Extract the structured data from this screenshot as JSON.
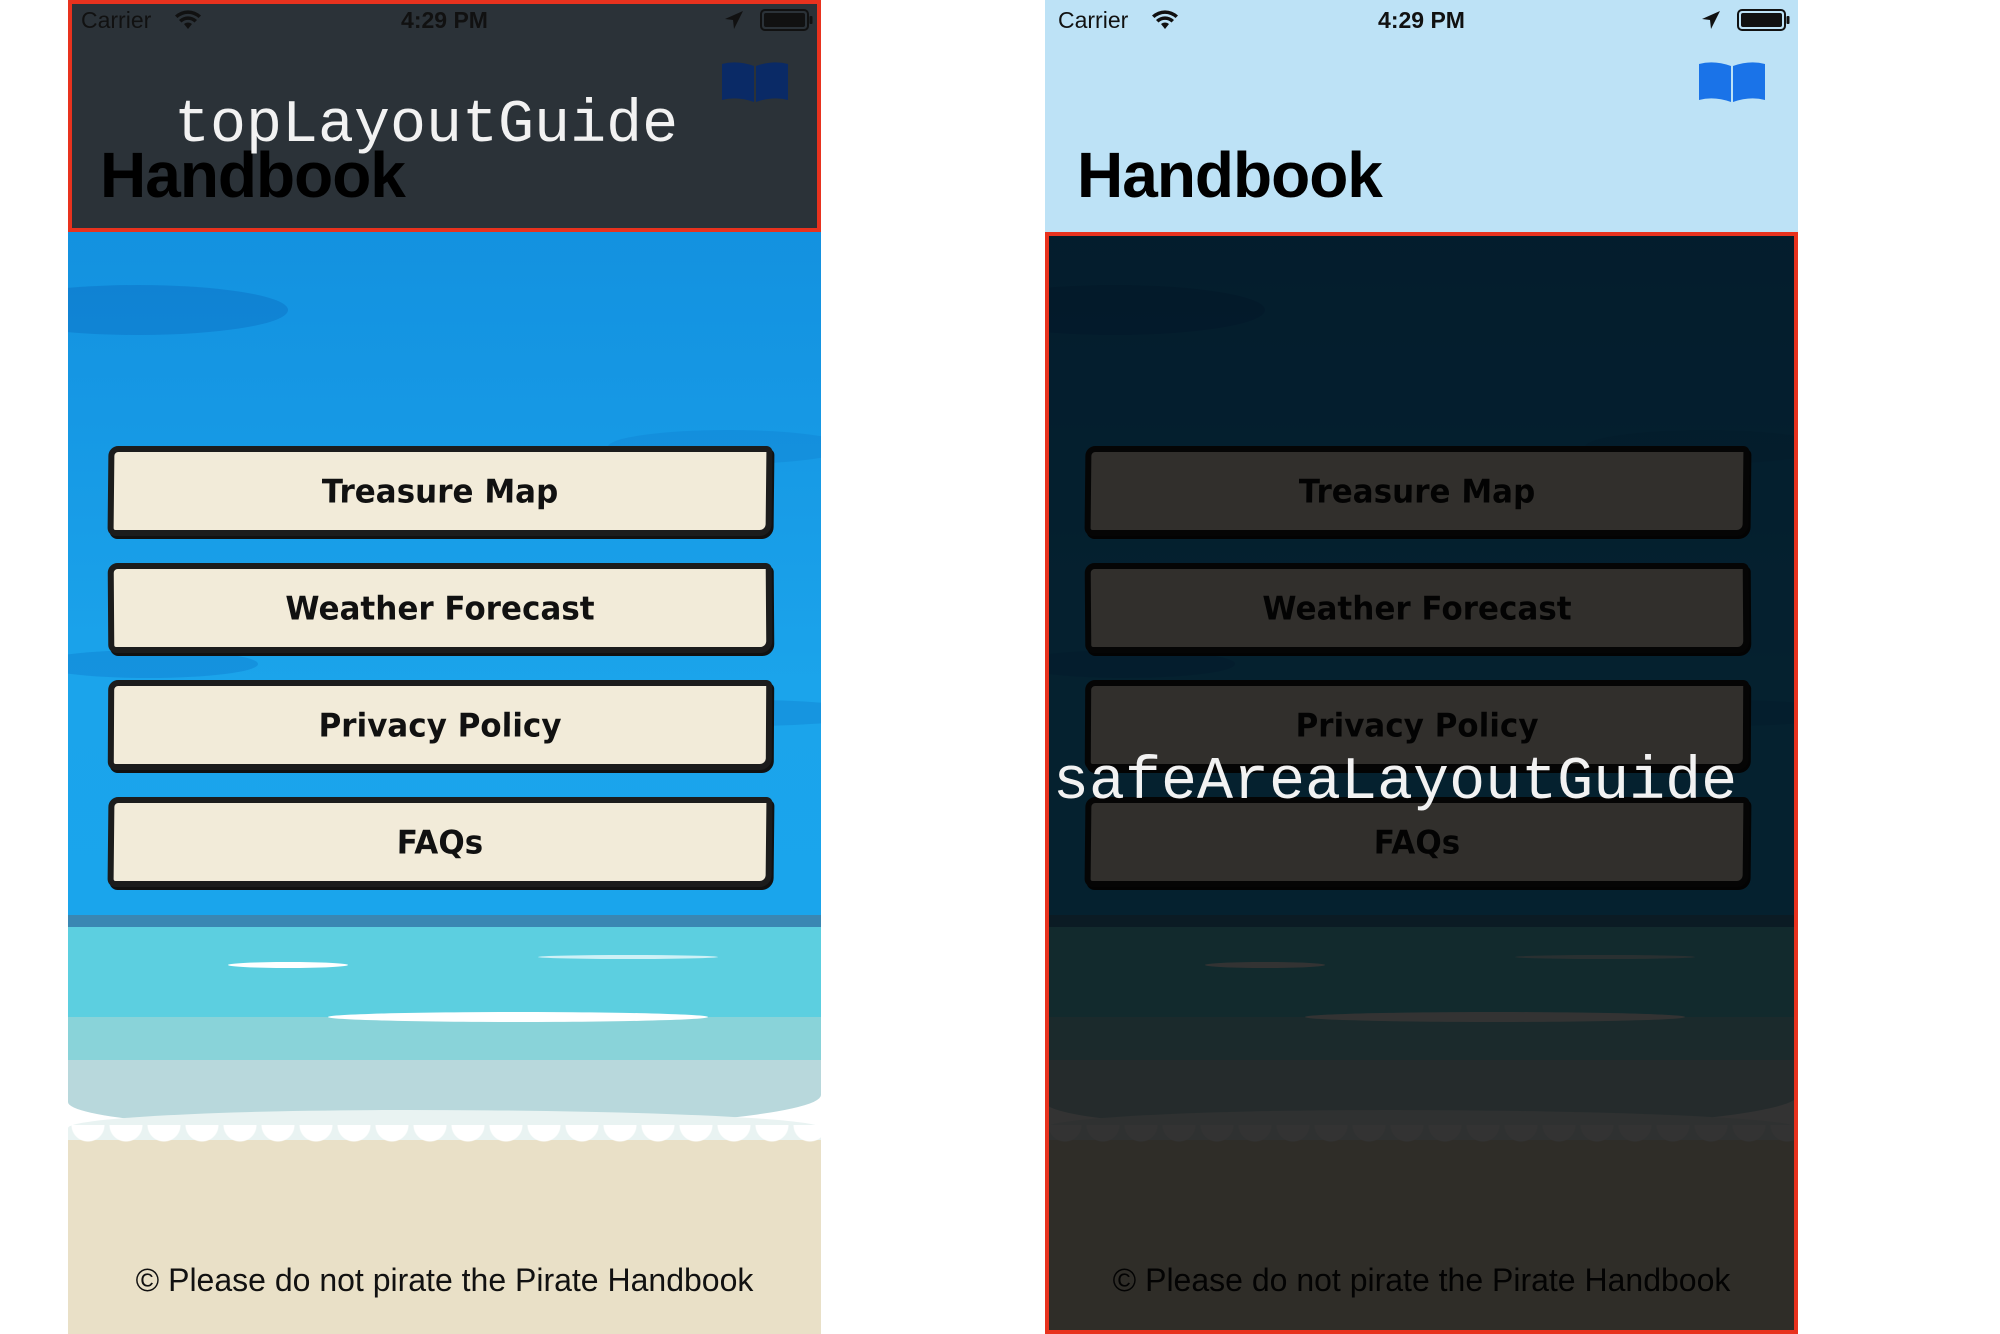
{
  "status_bar": {
    "carrier": "Carrier",
    "time": "4:29 PM"
  },
  "nav": {
    "title": "Handbook",
    "book_icon": "book-icon"
  },
  "menu": {
    "items": [
      {
        "label": "Treasure Map"
      },
      {
        "label": "Weather Forecast"
      },
      {
        "label": "Privacy Policy"
      },
      {
        "label": "FAQs"
      }
    ]
  },
  "footer": {
    "text": "© Please do not pirate the Pirate Handbook"
  },
  "annotations": {
    "top_label": "topLayoutGuide",
    "safe_label": "safeAreaLayoutGuide",
    "highlight_color": "#e8321e"
  },
  "colors": {
    "left_nav_bg": "#2b3238",
    "right_nav_bg": "#bde2f6",
    "book_icon_left": "#0a2a66",
    "book_icon_right": "#1a73e8",
    "plank_fill": "#f2ebd9"
  }
}
